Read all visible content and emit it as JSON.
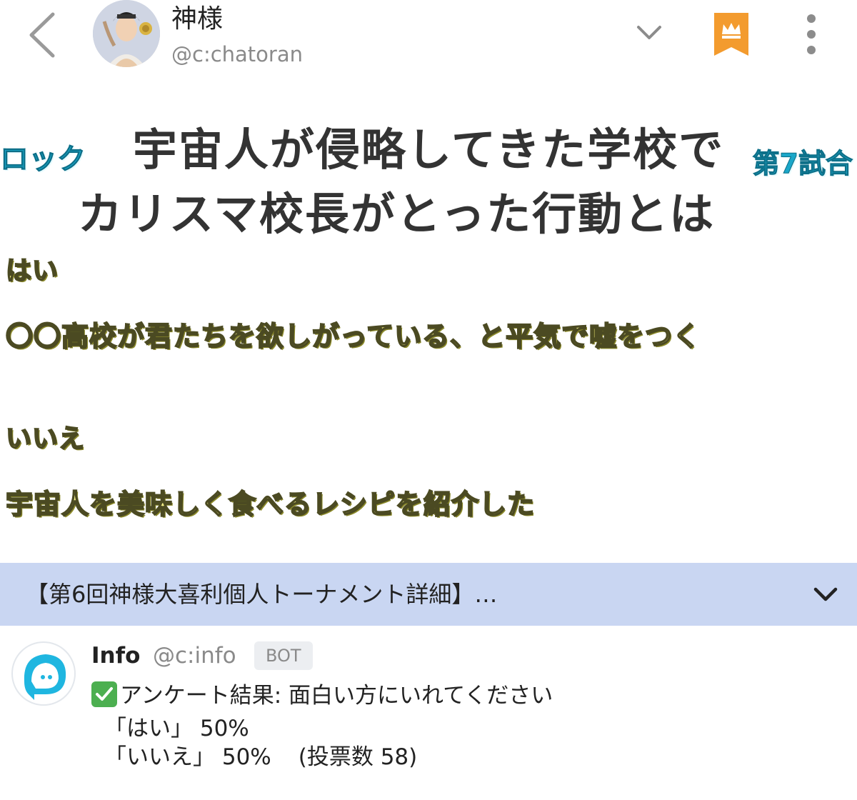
{
  "header": {
    "username": "神様",
    "handle": "@c:chatoran",
    "icons": [
      "back-chevron-icon",
      "avatar",
      "chevron-down-icon",
      "crown-bookmark-icon",
      "more-vertical-icon"
    ],
    "accent_color": "#f39b2e"
  },
  "post": {
    "block_label": "ロック",
    "match_label": "第7試合",
    "headline_line1": "宇宙人が侵略してきた学校で",
    "headline_line2": "カリスマ校長がとった行動とは",
    "option_yes_label": "はい",
    "option_yes_answer": "〇〇高校が君たちを欲しがっている、と平気で嘘をつく",
    "option_no_label": "いいえ",
    "option_no_answer": "宇宙人を美味しく食べるレシピを紹介した"
  },
  "banner": {
    "text": "【第6回神様大喜利個人トーナメント詳細】…",
    "background": "#c9d6f2"
  },
  "reply": {
    "name": "Info",
    "handle": "@c:info",
    "badge": "BOT",
    "line1": "アンケート結果: 面白い方にいれてください",
    "line2": "「はい」 50%",
    "line3_choice": "「いいえ」 50%",
    "line3_votes": "(投票数 58)"
  }
}
